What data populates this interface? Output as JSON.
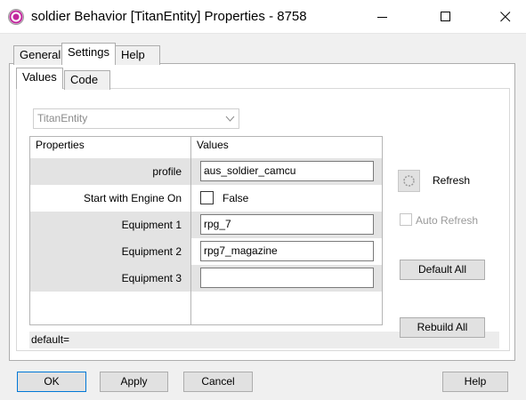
{
  "window": {
    "title": "soldier Behavior [TitanEntity] Properties - 8758",
    "minimize_icon": "minimize-icon",
    "maximize_icon": "maximize-icon",
    "close_icon": "close-icon"
  },
  "tabs": [
    "General",
    "Settings",
    "Help"
  ],
  "active_tab": "Settings",
  "subtabs": [
    "Values",
    "Code"
  ],
  "active_subtab": "Values",
  "entity_select": {
    "value": "TitanEntity"
  },
  "grid": {
    "headers": [
      "Properties",
      "Values"
    ],
    "rows": [
      {
        "label": "profile",
        "type": "text",
        "value": "aus_soldier_camcu"
      },
      {
        "label": "Start with Engine On",
        "type": "checkbox",
        "checked": false,
        "value": "False"
      },
      {
        "label": "Equipment 1",
        "type": "text",
        "value": "rpg_7"
      },
      {
        "label": "Equipment 2",
        "type": "text",
        "value": "rpg7_magazine"
      },
      {
        "label": "Equipment 3",
        "type": "text",
        "value": ""
      }
    ]
  },
  "status_text": "default=",
  "side": {
    "refresh_label": "Refresh",
    "auto_refresh_label": "Auto Refresh",
    "default_all_label": "Default All",
    "rebuild_all_label": "Rebuild All"
  },
  "footer": {
    "ok_label": "OK",
    "apply_label": "Apply",
    "cancel_label": "Cancel",
    "help_label": "Help"
  }
}
